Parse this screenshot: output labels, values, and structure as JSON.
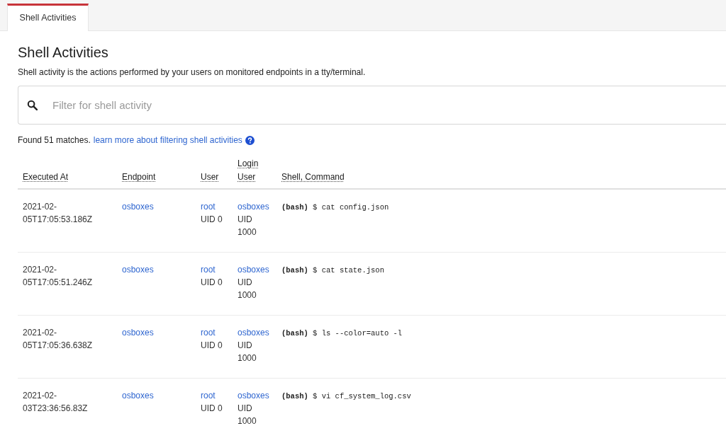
{
  "tabs": [
    {
      "label": "Shell Activities",
      "selected": true
    }
  ],
  "page": {
    "title": "Shell Activities",
    "description": "Shell activity is the actions performed by your users on monitored endpoints in a tty/terminal."
  },
  "search": {
    "placeholder": "Filter for shell activity"
  },
  "results": {
    "summary": "Found 51 matches.",
    "help_link": "learn more about filtering shell activities"
  },
  "table": {
    "columns": [
      "Executed At",
      "Endpoint",
      "User",
      "Login User",
      "Shell, Command"
    ],
    "rows": [
      {
        "executed_at": "2021-02-05T17:05:53.186Z",
        "endpoint": "osboxes",
        "user": "root",
        "user_uid": "UID 0",
        "login_user": "osboxes",
        "login_uid": "UID 1000",
        "command": "**(bash)** $ cat config.json"
      },
      {
        "executed_at": "2021-02-05T17:05:51.246Z",
        "endpoint": "osboxes",
        "user": "root",
        "user_uid": "UID 0",
        "login_user": "osboxes",
        "login_uid": "UID 1000",
        "command": "**(bash)** $ cat state.json"
      },
      {
        "executed_at": "2021-02-05T17:05:36.638Z",
        "endpoint": "osboxes",
        "user": "root",
        "user_uid": "UID 0",
        "login_user": "osboxes",
        "login_uid": "UID 1000",
        "command": "**(bash)** $ ls --color=auto -l"
      },
      {
        "executed_at": "2021-02-03T23:36:56.83Z",
        "endpoint": "osboxes",
        "user": "root",
        "user_uid": "UID 0",
        "login_user": "osboxes",
        "login_uid": "UID 1000",
        "command": "**(bash)** $ vi cf_system_log.csv"
      }
    ]
  }
}
